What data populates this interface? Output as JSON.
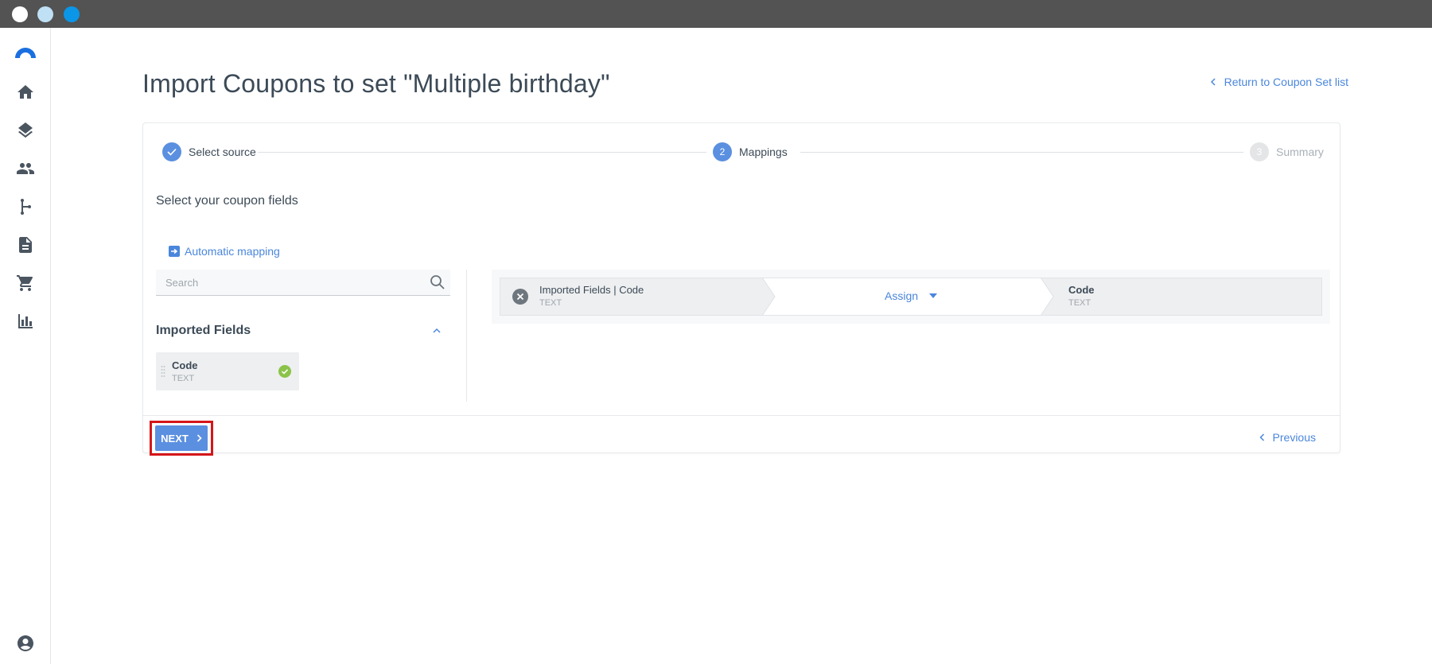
{
  "window": {
    "buttons": [
      "close",
      "minimize",
      "maximize"
    ]
  },
  "sidebar": {
    "logo": "brand-logo",
    "items": [
      {
        "name": "home",
        "icon": "home-icon"
      },
      {
        "name": "layers",
        "icon": "layers-icon"
      },
      {
        "name": "people",
        "icon": "people-icon"
      },
      {
        "name": "flow",
        "icon": "branch-icon"
      },
      {
        "name": "documents",
        "icon": "document-icon"
      },
      {
        "name": "cart",
        "icon": "cart-icon"
      },
      {
        "name": "analytics",
        "icon": "bar-chart-icon"
      }
    ],
    "account_icon": "account-icon"
  },
  "header": {
    "title": "Import Coupons to set \"Multiple birthday\"",
    "return_link": "Return to Coupon Set list"
  },
  "stepper": {
    "steps": [
      {
        "number": "1",
        "label": "Select source",
        "state": "done"
      },
      {
        "number": "2",
        "label": "Mappings",
        "state": "active"
      },
      {
        "number": "3",
        "label": "Summary",
        "state": "pending"
      }
    ]
  },
  "mapping": {
    "section_title": "Select your coupon fields",
    "automatic_mapping": "Automatic mapping",
    "search_placeholder": "Search",
    "imported_fields_title": "Imported Fields",
    "fields": [
      {
        "name": "Code",
        "type": "TEXT",
        "mapped": true
      }
    ],
    "rows": [
      {
        "source_name": "Imported Fields | Code",
        "source_type": "TEXT",
        "action": "Assign",
        "target_name": "Code",
        "target_type": "TEXT"
      }
    ]
  },
  "footer": {
    "next_label": "NEXT",
    "previous_label": "Previous"
  },
  "colors": {
    "accent": "#4a86dc",
    "step_active": "#5b8fe0",
    "highlight": "#d5161a",
    "success": "#8bc34a"
  }
}
